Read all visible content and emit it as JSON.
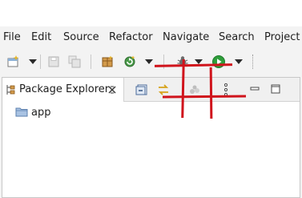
{
  "menu": [
    {
      "name": "menu-file",
      "label": "File"
    },
    {
      "name": "menu-edit",
      "label": "Edit"
    },
    {
      "name": "menu-source",
      "label": "Source"
    },
    {
      "name": "menu-refactor",
      "label": "Refactor"
    },
    {
      "name": "menu-navigate",
      "label": "Navigate"
    },
    {
      "name": "menu-search",
      "label": "Search"
    },
    {
      "name": "menu-project",
      "label": "Project"
    }
  ],
  "toolbar": {
    "icons": [
      "new-wizard-icon",
      "save-icon",
      "save-all-icon",
      "new-package-icon",
      "refresh-icon",
      "debug-icon",
      "run-icon"
    ]
  },
  "view": {
    "tab_label": "Package Explorer",
    "tree": [
      {
        "label": "app",
        "icon": "folder-icon"
      }
    ]
  },
  "colors": {
    "annotation": "#d0141c",
    "run_green": "#2e9e3a",
    "folder_blue": "#7fa3cf"
  }
}
